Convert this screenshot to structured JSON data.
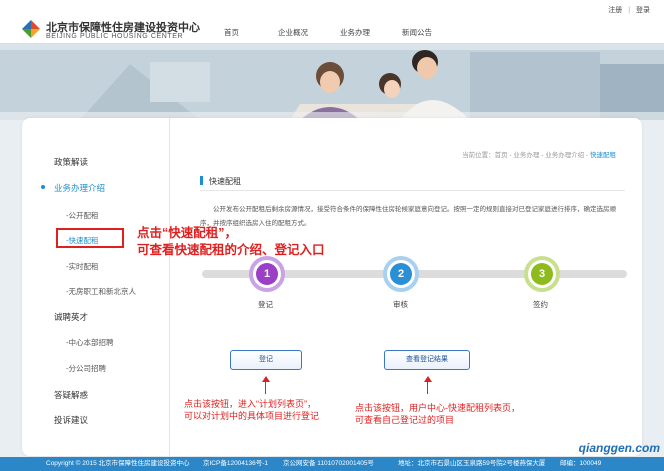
{
  "header": {
    "brand_cn": "北京市保障性住房建设投资中心",
    "brand_en": "BEIJING PUBLIC HOUSING CENTER",
    "nav": [
      "首页",
      "企业概况",
      "业务办理",
      "新闻公告"
    ],
    "register": "注册",
    "separator": "|",
    "login": "登录"
  },
  "sidebar": {
    "policy": "政策解读",
    "business": "业务办理介绍",
    "public_rent": "-公开配租",
    "quick_rent": "-快速配租",
    "realtime_rent": "-实时配租",
    "no_house": "-无房职工和新北京人",
    "recruit": "诚聘英才",
    "hq_recruit": "-中心本部招聘",
    "branch_recruit": "-分公司招聘",
    "faq": "答疑解惑",
    "complaint": "投诉建议"
  },
  "main": {
    "breadcrumb_prefix": "当前位置：首页 - 业务办理 - 业务办理介绍 - ",
    "breadcrumb_current": "快速配租",
    "section_title": "快速配租",
    "description": "公开发布公开配租后剩余房源情况，接受符合条件的保障性住房轮候家庭意向登记。按照一定的规则直接对已登记家庭进行排序，确定选房顺序，并按序组织选房入住的配租方式。",
    "steps": [
      {
        "num": "1",
        "label": "登记"
      },
      {
        "num": "2",
        "label": "审核"
      },
      {
        "num": "3",
        "label": "签约"
      }
    ],
    "btn_register": "登记",
    "btn_view": "查看登记结果"
  },
  "annotations": {
    "big_line1": "点击“快速配租”，",
    "big_line2": "可查看快速配租的介绍、登记入口",
    "left_line1": "点击该按钮，进入“计划列表页”，",
    "left_line2": "可以对计划中的具体项目进行登记",
    "right_line1": "点击该按钮，用户中心-快速配租列表页，",
    "right_line2": "可查看自己登记过的项目"
  },
  "footer": {
    "copyright": "Copyright © 2015 北京市保障性住房建设投资中心",
    "icp": "京ICP备12004136号-1",
    "police": "京公网安备 11010702001405号",
    "address": "地址：北京市石景山区玉泉路59号院2号楼燕保大厦",
    "postcode": "邮编：100049"
  },
  "watermark": "qianggen.com",
  "colors": {
    "accent": "#1d8ed0",
    "step1": "#9b3fc6",
    "step1_ring": "#c9a3e6",
    "step2": "#2b8fd6",
    "step2_ring": "#a8d0ef",
    "step3": "#8dbb1e",
    "step3_ring": "#c8e08e",
    "annotation": "#e02020",
    "footer": "#2c87c8"
  }
}
